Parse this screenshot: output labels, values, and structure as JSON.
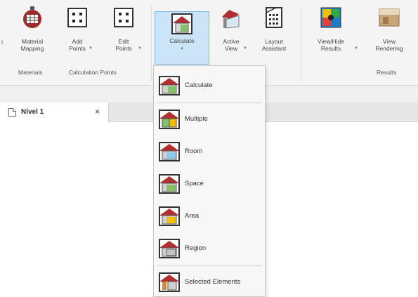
{
  "ribbon": {
    "left_cut_label": "t",
    "buttons": [
      {
        "label": "Material\nMapping"
      },
      {
        "label": "Add\nPoints"
      },
      {
        "label": "Edit\nPoints"
      },
      {
        "label": "Calculate"
      },
      {
        "label": "Active\nView"
      },
      {
        "label": "Layout\nAssistant"
      },
      {
        "label": "View/Hide\nResults"
      },
      {
        "label": "View\nRendering"
      }
    ],
    "groups": {
      "materials": "Materials",
      "calculation_points": "Calculation Points",
      "results": "Results"
    }
  },
  "document_tab": {
    "label": "Nivel 1",
    "close": "×"
  },
  "calculate_menu": {
    "items": [
      {
        "label": "Calculate",
        "icon": "calculate-icon"
      },
      {
        "label": "Multiple",
        "icon": "multiple-icon"
      },
      {
        "label": "Room",
        "icon": "room-icon"
      },
      {
        "label": "Space",
        "icon": "space-icon"
      },
      {
        "label": "Area",
        "icon": "area-icon"
      },
      {
        "label": "Region",
        "icon": "region-icon"
      },
      {
        "label": "Selected Elements",
        "icon": "selected-elements-icon"
      }
    ]
  },
  "colors": {
    "active_button_bg": "#cce4f7",
    "active_button_border": "#7eb4ea",
    "icon_red": "#b03030",
    "ribbon_bg": "#f4f4f4"
  }
}
